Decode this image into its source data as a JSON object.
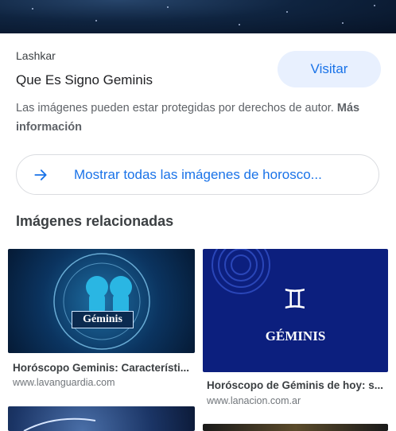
{
  "result": {
    "source": "Lashkar",
    "title": "Que Es Signo Geminis",
    "visit_label": "Visitar",
    "notice_text": "Las imágenes pueden estar protegidas por derechos de autor.",
    "notice_link": "Más información"
  },
  "show_all": {
    "label": "Mostrar todas las imágenes de horosco..."
  },
  "related": {
    "heading": "Imágenes relacionadas",
    "items": [
      {
        "image_text": "Géminis",
        "title": "Horóscopo Geminis: Característi...",
        "url": "www.lavanguardia.com"
      },
      {
        "image_text": "GÉMINIS",
        "symbol": "♊",
        "title": "Horóscopo de Géminis de hoy: s...",
        "url": "www.lanacion.com.ar"
      }
    ]
  },
  "icons": {
    "arrow": "arrow-right-icon",
    "symbol": "gemini-symbol-icon"
  },
  "colors": {
    "accent": "#1a73e8",
    "visit_bg": "#e8f0fe"
  }
}
